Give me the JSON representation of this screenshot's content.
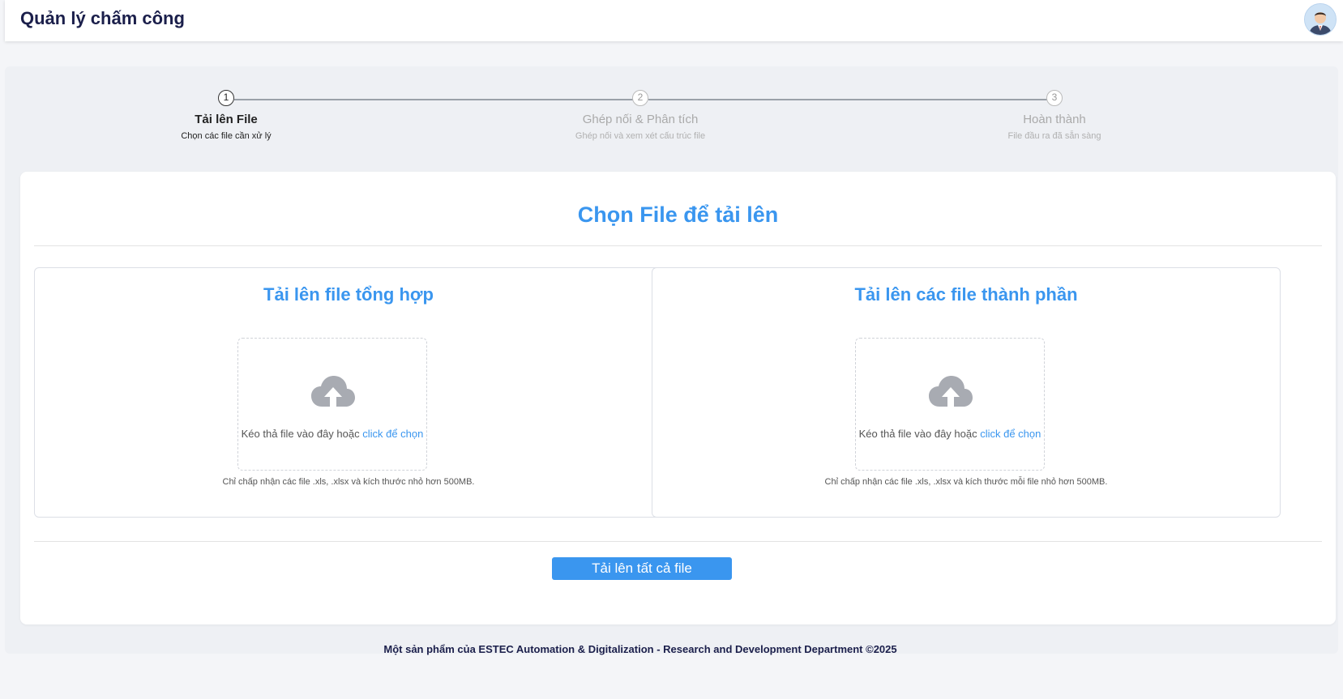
{
  "app": {
    "title": "Quản lý chấm công"
  },
  "stepper": {
    "steps": [
      {
        "number": "1",
        "title": "Tải lên File",
        "subtitle": "Chọn các file cần xử lý",
        "active": true
      },
      {
        "number": "2",
        "title": "Ghép nối & Phân tích",
        "subtitle": "Ghép nối và xem xét cấu trúc file",
        "active": false
      },
      {
        "number": "3",
        "title": "Hoàn thành",
        "subtitle": "File đầu ra đã sẵn sàng",
        "active": false
      }
    ]
  },
  "card": {
    "title": "Chọn File để tải lên",
    "panels": [
      {
        "title": "Tải lên file tổng hợp",
        "drop_text": "Kéo thả file vào đây hoặc ",
        "drop_link": "click để chọn",
        "hint": "Chỉ chấp nhận các file .xls, .xlsx và kích thước nhỏ hơn 500MB.",
        "icon": "cloud-upload-icon"
      },
      {
        "title": "Tải lên các file thành phần",
        "drop_text": "Kéo thả file vào đây hoặc ",
        "drop_link": "click để chọn",
        "hint": "Chỉ chấp nhận các file .xls, .xlsx và kích thước mỗi file nhỏ hơn 500MB.",
        "icon": "cloud-upload-icon"
      }
    ],
    "upload_all_label": "Tải lên tất cả file"
  },
  "footer": {
    "text": "Một sản phẩm của ESTEC Automation & Digitalization - Research and Development Department ©2025"
  },
  "colors": {
    "accent": "#3a96ef",
    "title": "#1b1f4b",
    "icon": "#a8abb2"
  }
}
